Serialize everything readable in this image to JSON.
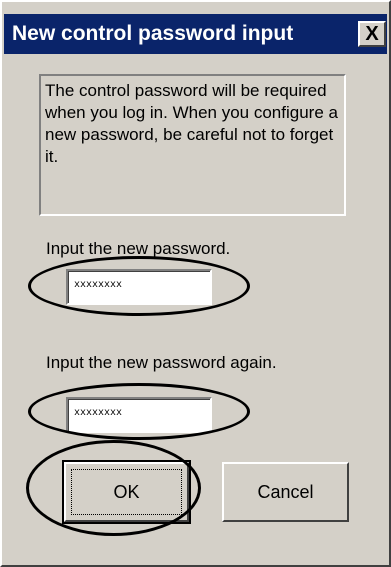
{
  "dialog": {
    "title": "New control password input",
    "close_label": "X",
    "info_text": "The control password will be required when you log in. When you configure a new password, be careful not to forget it.",
    "password_label": "Input the new password.",
    "password_value": "xxxxxxxx",
    "confirm_label": "Input the new password again.",
    "confirm_value": "xxxxxxxx",
    "ok_label": "OK",
    "cancel_label": "Cancel"
  },
  "colors": {
    "titlebar": "#0a246a",
    "dialog_face": "#d4d0c8",
    "annotation_ellipses": "#000000"
  }
}
